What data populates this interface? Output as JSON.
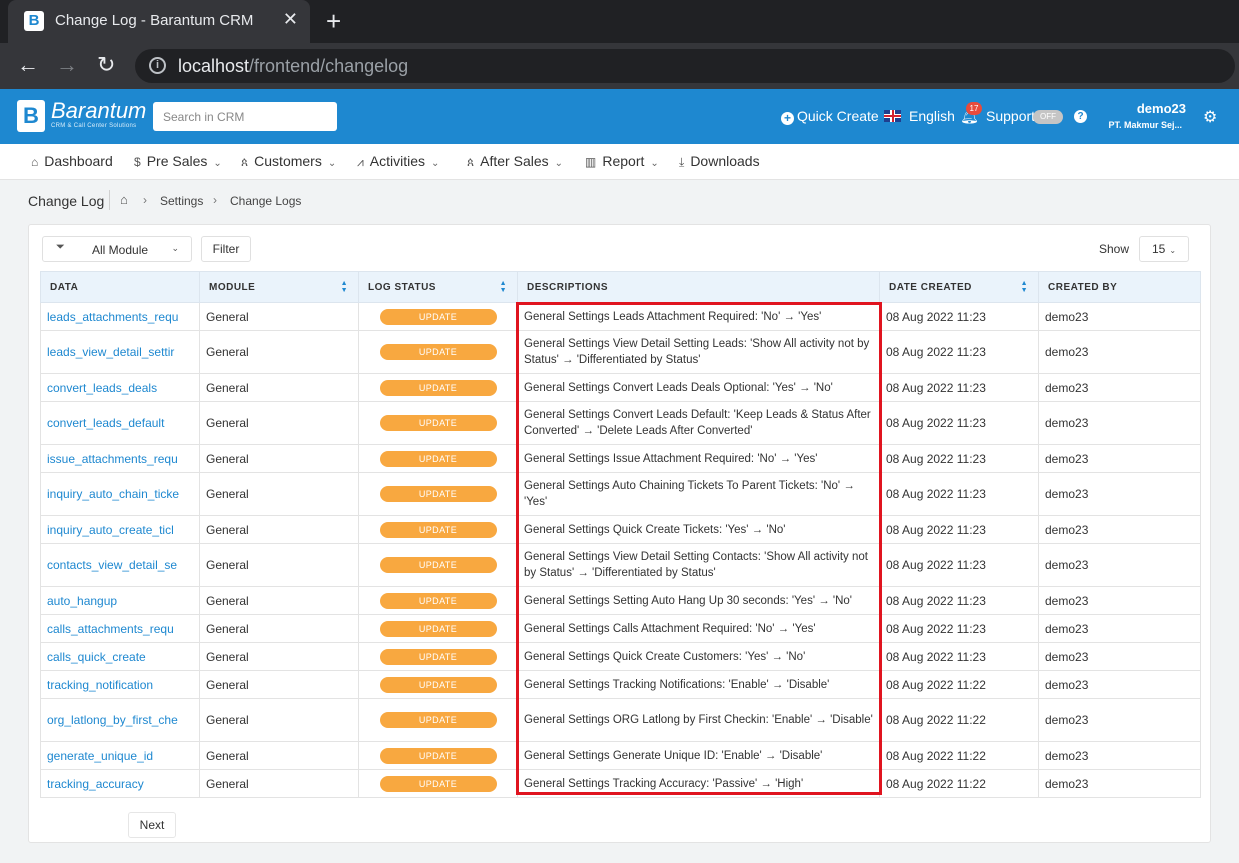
{
  "browser": {
    "tab_title": "Change Log - Barantum CRM",
    "url_host": "localhost",
    "url_path": "/frontend/changelog"
  },
  "header": {
    "logo_text": "Barantum",
    "logo_sub": "CRM & Call Center Solutions",
    "search_placeholder": "Search in CRM",
    "quick_create": "Quick Create",
    "language": "English",
    "notification_count": "17",
    "support": "Support",
    "support_toggle": "OFF",
    "user_name": "demo23",
    "user_company": "PT. Makmur Sej..."
  },
  "nav": {
    "items": [
      {
        "label": "Dashboard",
        "icon": "home-icon"
      },
      {
        "label": "Pre Sales",
        "icon": "dollar-icon"
      },
      {
        "label": "Customers",
        "icon": "users-icon"
      },
      {
        "label": "Activities",
        "icon": "pulse-icon"
      },
      {
        "label": "After Sales",
        "icon": "users-icon"
      },
      {
        "label": "Report",
        "icon": "bar-chart-icon"
      },
      {
        "label": "Downloads",
        "icon": "download-icon"
      }
    ]
  },
  "breadcrumb": {
    "title": "Change Log",
    "items": [
      "Settings",
      "Change Logs"
    ]
  },
  "toolbar": {
    "module_filter": "All Module",
    "filter_button": "Filter",
    "show_label": "Show",
    "show_value": "15"
  },
  "table": {
    "columns": [
      "DATA",
      "MODULE",
      "LOG STATUS",
      "DESCRIPTIONS",
      "DATE CREATED",
      "CREATED BY"
    ],
    "rows": [
      {
        "data": "leads_attachments_requ",
        "module": "General",
        "status": "UPDATE",
        "desc": "General Settings Leads Attachment Required: 'No' → 'Yes'",
        "date": "08 Aug 2022 11:23",
        "by": "demo23"
      },
      {
        "data": "leads_view_detail_settir",
        "module": "General",
        "status": "UPDATE",
        "desc": "General Settings View Detail Setting Leads: 'Show All activity not by Status' → 'Differentiated by Status'",
        "date": "08 Aug 2022 11:23",
        "by": "demo23"
      },
      {
        "data": "convert_leads_deals",
        "module": "General",
        "status": "UPDATE",
        "desc": "General Settings Convert Leads Deals Optional: 'Yes' → 'No'",
        "date": "08 Aug 2022 11:23",
        "by": "demo23"
      },
      {
        "data": "convert_leads_default",
        "module": "General",
        "status": "UPDATE",
        "desc": "General Settings Convert Leads Default: 'Keep Leads & Status After Converted' → 'Delete Leads After Converted'",
        "date": "08 Aug 2022 11:23",
        "by": "demo23"
      },
      {
        "data": "issue_attachments_requ",
        "module": "General",
        "status": "UPDATE",
        "desc": "General Settings Issue Attachment Required: 'No' → 'Yes'",
        "date": "08 Aug 2022 11:23",
        "by": "demo23"
      },
      {
        "data": "inquiry_auto_chain_ticke",
        "module": "General",
        "status": "UPDATE",
        "desc": "General Settings Auto Chaining Tickets To Parent Tickets: 'No' → 'Yes'",
        "date": "08 Aug 2022 11:23",
        "by": "demo23"
      },
      {
        "data": "inquiry_auto_create_ticl",
        "module": "General",
        "status": "UPDATE",
        "desc": "General Settings Quick Create Tickets: 'Yes' → 'No'",
        "date": "08 Aug 2022 11:23",
        "by": "demo23"
      },
      {
        "data": "contacts_view_detail_se",
        "module": "General",
        "status": "UPDATE",
        "desc": "General Settings View Detail Setting Contacts: 'Show All activity not by Status' → 'Differentiated by Status'",
        "date": "08 Aug 2022 11:23",
        "by": "demo23"
      },
      {
        "data": "auto_hangup",
        "module": "General",
        "status": "UPDATE",
        "desc": "General Settings Setting Auto Hang Up 30 seconds: 'Yes' → 'No'",
        "date": "08 Aug 2022 11:23",
        "by": "demo23"
      },
      {
        "data": "calls_attachments_requ",
        "module": "General",
        "status": "UPDATE",
        "desc": "General Settings Calls Attachment Required: 'No' → 'Yes'",
        "date": "08 Aug 2022 11:23",
        "by": "demo23"
      },
      {
        "data": "calls_quick_create",
        "module": "General",
        "status": "UPDATE",
        "desc": "General Settings Quick Create Customers: 'Yes' → 'No'",
        "date": "08 Aug 2022 11:23",
        "by": "demo23"
      },
      {
        "data": "tracking_notification",
        "module": "General",
        "status": "UPDATE",
        "desc": "General Settings Tracking Notifications: 'Enable' → 'Disable'",
        "date": "08 Aug 2022 11:22",
        "by": "demo23"
      },
      {
        "data": "org_latlong_by_first_che",
        "module": "General",
        "status": "UPDATE",
        "desc": "General Settings ORG Latlong by First Checkin: 'Enable' → 'Disable'",
        "date": "08 Aug 2022 11:22",
        "by": "demo23"
      },
      {
        "data": "generate_unique_id",
        "module": "General",
        "status": "UPDATE",
        "desc": "General Settings Generate Unique ID: 'Enable' → 'Disable'",
        "date": "08 Aug 2022 11:22",
        "by": "demo23"
      },
      {
        "data": "tracking_accuracy",
        "module": "General",
        "status": "UPDATE",
        "desc": "General Settings Tracking Accuracy: 'Passive' → 'High'",
        "date": "08 Aug 2022 11:22",
        "by": "demo23"
      }
    ]
  },
  "pagination": {
    "next": "Next"
  },
  "colors": {
    "brand": "#1e88d0",
    "status_update": "#f8a840",
    "highlight": "#e0141f"
  }
}
